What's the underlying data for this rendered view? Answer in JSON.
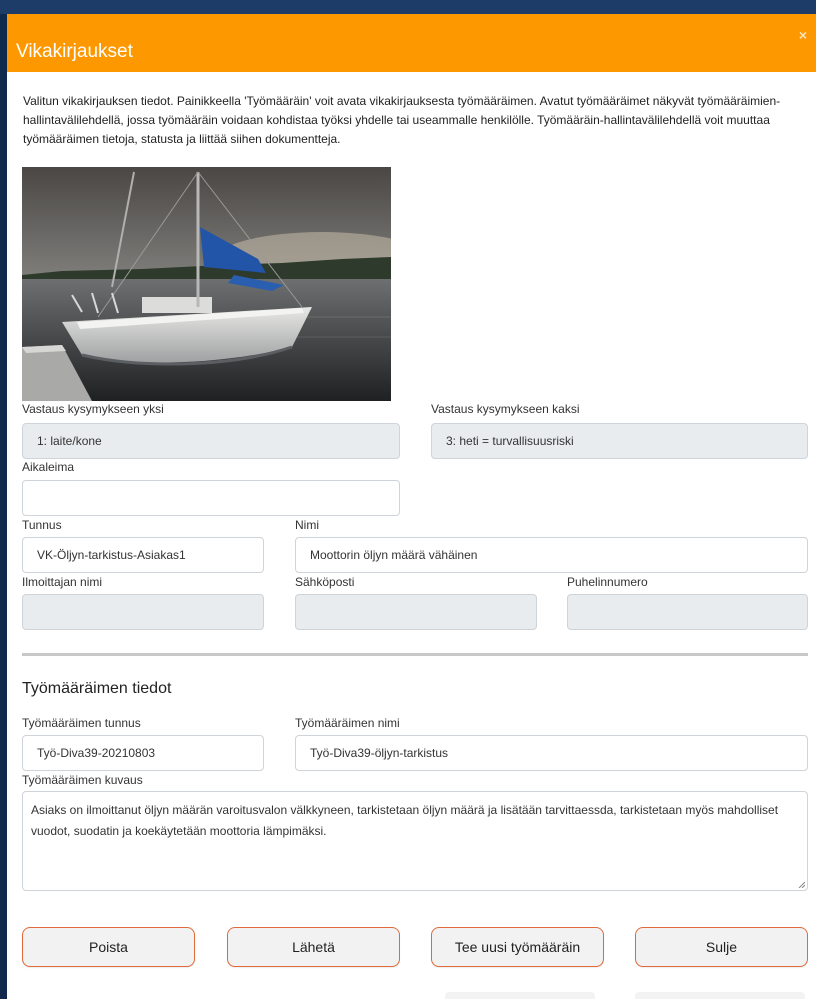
{
  "modal": {
    "title": "Vikakirjaukset",
    "close_label": "×",
    "description": "Valitun vikakirjauksen tiedot. Painikkeella 'Työmääräin' voit avata vikakirjauksesta työmääräimen. Avatut työmääräimet näkyvät työmääräimien-hallintavälilehdellä, jossa työmääräin voidaan kohdistaa työksi yhdelle tai useammalle henkilölle. Työmääräin-hallintavälilehdellä voit muuttaa työmääräimen tietoja, statusta ja liittää siihen dokumentteja."
  },
  "report": {
    "q1_label": "Vastaus kysymykseen yksi",
    "q1_value": "1: laite/kone",
    "q2_label": "Vastaus kysymykseen kaksi",
    "q2_value": "3: heti = turvallisuusriski",
    "timestamp_label": "Aikaleima",
    "timestamp_value": "",
    "id_label": "Tunnus",
    "id_value": "VK-Öljyn-tarkistus-Asiakas1",
    "name_label": "Nimi",
    "name_value": "Moottorin öljyn määrä vähäinen",
    "reporter_label": "Ilmoittajan nimi",
    "reporter_value": "",
    "email_label": "Sähköposti",
    "email_value": "",
    "phone_label": "Puhelinnumero",
    "phone_value": ""
  },
  "work_order": {
    "section_title": "Työmääräimen tiedot",
    "id_label": "Työmääräimen tunnus",
    "id_value": "Työ-Diva39-20210803",
    "name_label": "Työmääräimen nimi",
    "name_value": "Työ-Diva39-öljyn-tarkistus",
    "desc_label": "Työmääräimen kuvaus",
    "desc_value": "Asiaks on ilmoittanut öljyn määrän varoitusvalon välkkyneen, tarkistetaan öljyn määrä ja lisätään tarvittaessda, tarkistetaan myös mahdolliset vuodot, suodatin ja koekäytetään moottoria lämpimäksi."
  },
  "buttons": {
    "delete": "Poista",
    "send": "Lähetä",
    "new_order": "Tee uusi työmääräin",
    "close": "Sulje"
  },
  "colors": {
    "header": "#fd9800",
    "button_border": "#e06a3a",
    "readonly_field": "#e9ecef"
  }
}
